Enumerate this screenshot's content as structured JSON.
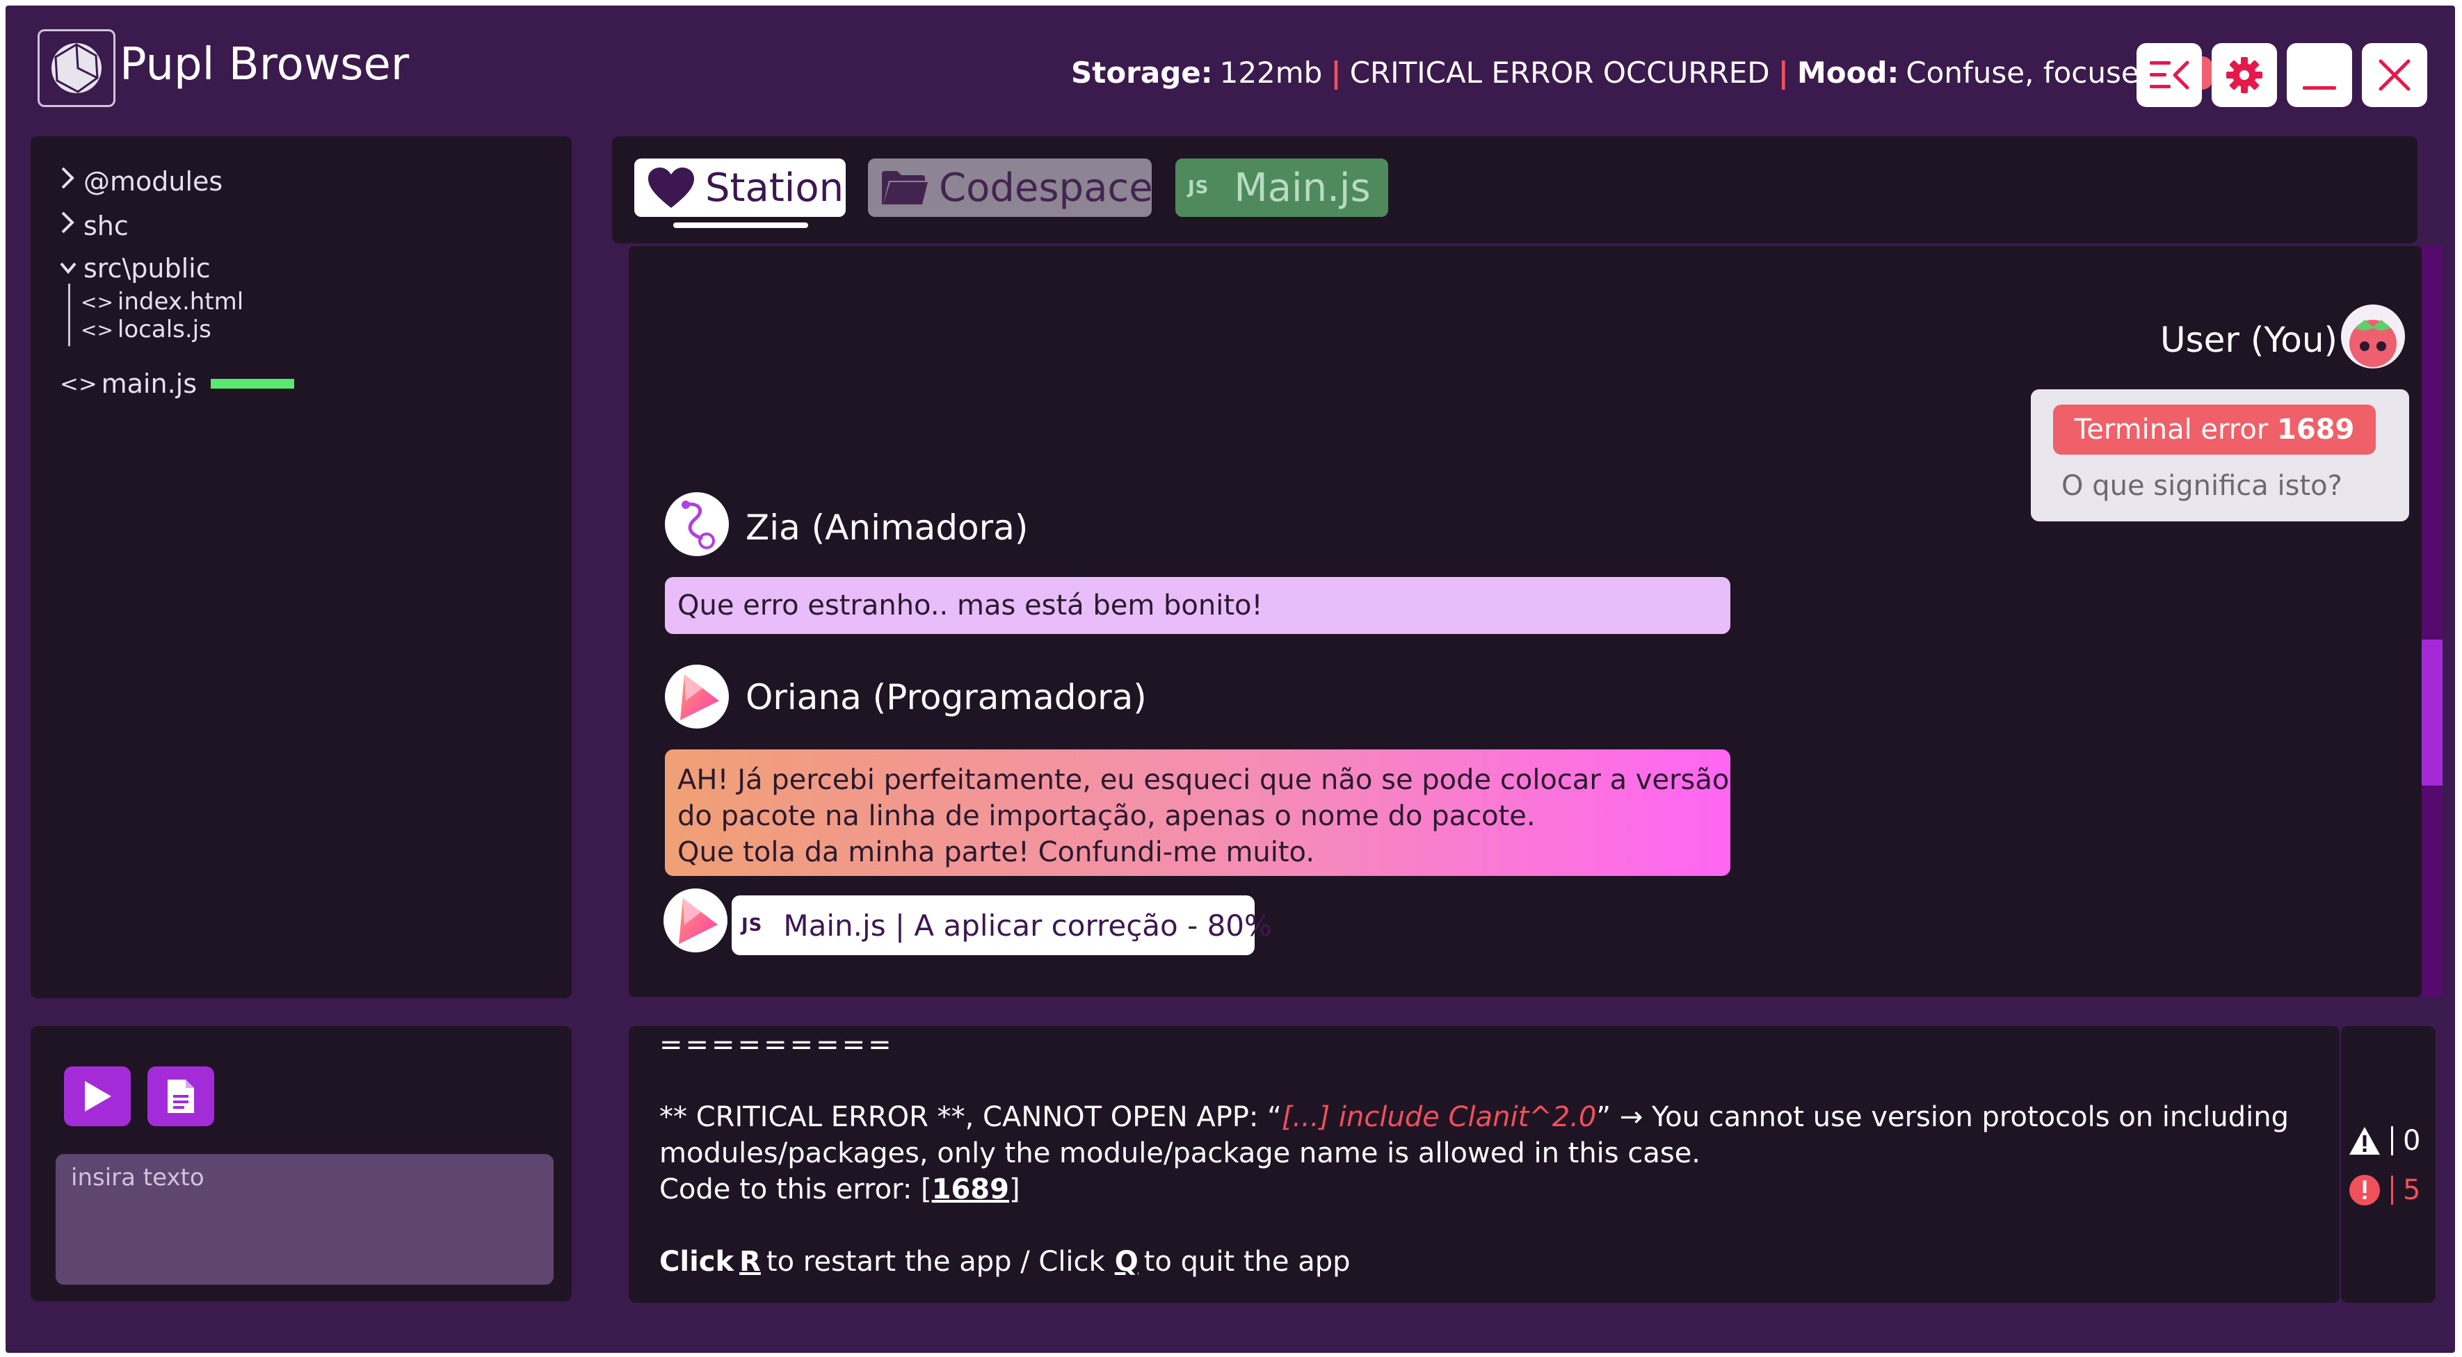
{
  "app": {
    "title": "Pupl Browser"
  },
  "status": {
    "storage_label": "Storage:",
    "storage_value": "122mb",
    "error_text": "CRITICAL ERROR OCCURRED",
    "mood_label": "Mood:",
    "mood_value": "Confuse, focused",
    "mood_color": "#f06070"
  },
  "window_buttons": [
    "menu-collapse-icon",
    "gear-icon",
    "minimize-icon",
    "close-icon"
  ],
  "explorer": {
    "items": [
      {
        "label": "@modules",
        "state": "collapsed"
      },
      {
        "label": "shc",
        "state": "collapsed"
      },
      {
        "label": "src\\public",
        "state": "expanded"
      },
      {
        "label": "index.html",
        "type": "file"
      },
      {
        "label": "locals.js",
        "type": "file"
      },
      {
        "label": "main.js",
        "type": "file",
        "progress_color": "#59e870"
      }
    ]
  },
  "tabs": [
    {
      "label": "Station",
      "icon": "heart-icon",
      "active": true
    },
    {
      "label": "Codespace",
      "icon": "folder-icon",
      "active": false
    },
    {
      "label": "Main.js",
      "icon": "js-icon",
      "active": false
    }
  ],
  "chat": {
    "user": {
      "name": "User (You)",
      "error_label": "Terminal error ",
      "error_code": "1689",
      "question": "O que significa isto?"
    },
    "zia": {
      "name": "Zia (Animadora)",
      "message": "Que erro estranho.. mas está bem bonito!"
    },
    "oriana": {
      "name": "Oriana (Programadora)",
      "line1": "AH! Já percebi perfeitamente, eu esqueci que não se pode colocar a versão",
      "line2": "do pacote na linha de importação, apenas o nome do pacote.",
      "line3": "Que tola da minha parte! Confundi-me muito."
    },
    "status_chip": {
      "js_tag": "JS",
      "text": "Main.js | A aplicar correção - 80%"
    }
  },
  "terminal": {
    "rule": "=========",
    "error_prefix": "** CRITICAL ERROR **, CANNOT OPEN APP: “",
    "error_snippet": "[...] include Clanit^2.0",
    "error_suffix": "” → You cannot use version protocols on including",
    "error_line2": "modules/packages, only the module/package name is allowed in this case.",
    "code_prefix": "Code to this error: [",
    "code_value": "1689",
    "code_suffix": "]",
    "click1": "Click",
    "key_r": "R",
    "restart_text": "to restart the app / Click",
    "key_q": "Q",
    "quit_text": "to quit the app",
    "warnings": "0",
    "errors": "5",
    "error_color": "#f0505a"
  },
  "controls": {
    "input_placeholder": "insira texto"
  }
}
